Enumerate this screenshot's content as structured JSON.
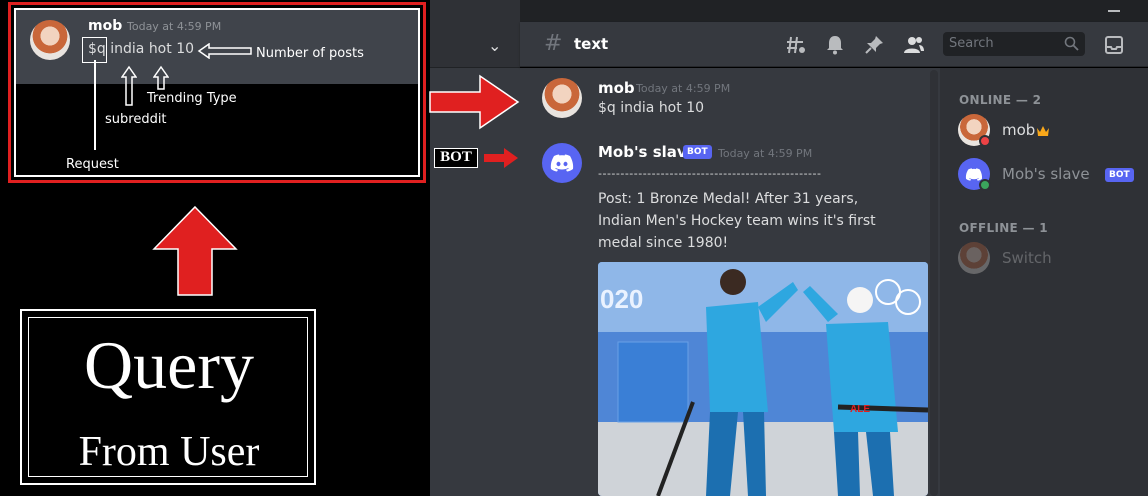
{
  "annotation": {
    "crop_message": {
      "author": "mob",
      "timestamp": "Today at 4:59 PM",
      "text": "$q india hot 10"
    },
    "labels": {
      "number_of_posts": "Number of posts",
      "trending_type": "Trending Type",
      "subreddit": "subreddit",
      "request": "Request"
    },
    "query_title": "Query",
    "query_subtitle": "From User",
    "bot_tag": "BOT",
    "colors": {
      "arrow": "#e02020",
      "crop_border": "#e02020"
    }
  },
  "channel": {
    "name": "text",
    "search_placeholder": "Search",
    "icons": [
      "threads-icon",
      "bell-icon",
      "pin-icon",
      "members-icon",
      "search-icon",
      "inbox-icon"
    ]
  },
  "messages": [
    {
      "author": "mob",
      "timestamp": "Today at 4:59 PM",
      "lines": [
        "$q india hot 10"
      ]
    },
    {
      "author": "Mob's slave",
      "badge": "BOT",
      "timestamp": "Today at 4:59 PM",
      "lines": [
        "--------------------------------------------------",
        "",
        "Post: 1 Bronze Medal! After 31 years,",
        "Indian Men's Hockey team wins it's first",
        "medal since 1980!"
      ],
      "embed_image_text": [
        "020",
        "ALE"
      ]
    }
  ],
  "members": {
    "online_header": "ONLINE — 2",
    "offline_header": "OFFLINE — 1",
    "online": [
      {
        "name": "mob",
        "status": "dnd",
        "crown": true
      },
      {
        "name": "Mob's slave",
        "badge": "BOT",
        "status": "online"
      }
    ],
    "offline": [
      {
        "name": "Switch"
      }
    ]
  },
  "colors": {
    "blurple": "#5865f2",
    "chat_bg": "#36393f",
    "sidebar_bg": "#2f3136",
    "status_online": "#3ba55d",
    "status_dnd": "#ed4245",
    "crown": "#faa81a"
  }
}
